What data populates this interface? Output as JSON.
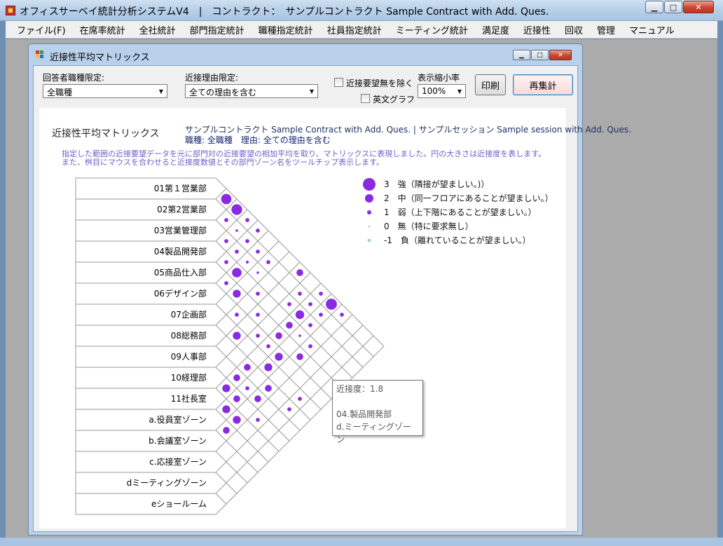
{
  "window": {
    "title": "オフィスサーベイ統計分析システムV4　|　コントラクト：　サンプルコントラクト Sample Contract with Add. Ques.",
    "minimize_glyph": "▁",
    "maximize_glyph": "□",
    "close_glyph": "✕"
  },
  "menu": [
    {
      "label": "ファイル(F)"
    },
    {
      "label": "在席率統計"
    },
    {
      "label": "全社統計"
    },
    {
      "label": "部門指定統計"
    },
    {
      "label": "職種指定統計"
    },
    {
      "label": "社員指定統計"
    },
    {
      "label": "ミーティング統計"
    },
    {
      "label": "満足度"
    },
    {
      "label": "近接性"
    },
    {
      "label": "回収"
    },
    {
      "label": "管理"
    },
    {
      "label": "マニュアル"
    }
  ],
  "dialog": {
    "title": "近接性平均マトリックス",
    "occupation_label": "回答者職種限定:",
    "occupation_value": "全職種",
    "reason_label": "近接理由限定:",
    "reason_value": "全ての理由を含む",
    "exclude_label": "近接要望無を除く",
    "english_label": "英文グラフ",
    "zoom_label": "表示縮小率",
    "zoom_value": "100%",
    "print_button": "印刷",
    "recalc_button": "再集計"
  },
  "panel": {
    "title": "近接性平均マトリックス",
    "info_line1": "サンプルコントラクト Sample Contract with Add. Ques. | サンプルセッション Sample session with Add. Ques.",
    "info_line2_prefix": "職種: ",
    "info_line2_value": "全職種",
    "info_line2_mid": "　理由: ",
    "info_line2_reason": "全ての理由を含む",
    "desc1": "指定した範囲の近接要望データを元に部門対の近接要望の相加平均を取り、マトリックスに表現しました。円の大きさは近接度を表します。",
    "desc2": "また、桝目にマウスを合わせると近接度数値とその部門ゾーン名をツールチップ表示します。"
  },
  "departments": [
    "01第１営業部",
    "02第2営業部",
    "03営業管理部",
    "04製品開発部",
    "05商品仕入部",
    "06デザイン部",
    "07企画部",
    "08総務部",
    "09人事部",
    "10経理部",
    "11社長室",
    "a.役員室ゾーン",
    "b.会議室ゾーン",
    "c.応接室ゾーン",
    "dミーティングゾーン",
    "eショールーム"
  ],
  "legend": [
    {
      "value": 3,
      "text": "3　強（隣接が望ましい。)）",
      "color": "#8a2be2"
    },
    {
      "value": 2,
      "text": "2　中（同一フロアにあることが望ましい。）",
      "color": "#8a2be2"
    },
    {
      "value": 1,
      "text": "1　弱（上下階にあることが望ましい。）",
      "color": "#8a2be2"
    },
    {
      "value": 0,
      "text": "0　無（特に要求無し）",
      "color": "#8a2be2"
    },
    {
      "value": -1,
      "text": "-1　負（離れていることが望ましい。）",
      "color": "#9fd3da"
    }
  ],
  "matrix_cells": [
    {
      "i": 0,
      "j": 1,
      "v": 2.2
    },
    {
      "i": 0,
      "j": 2,
      "v": 2.3
    },
    {
      "i": 1,
      "j": 2,
      "v": 0.6
    },
    {
      "i": 2,
      "j": 3,
      "v": 0.6
    },
    {
      "i": 1,
      "j": 4,
      "v": 0.6
    },
    {
      "i": 2,
      "j": 4,
      "v": 0.6
    },
    {
      "i": 3,
      "j": 4,
      "v": 0.6
    },
    {
      "i": 0,
      "j": 3,
      "v": 0.6
    },
    {
      "i": 0,
      "j": 4,
      "v": 0.6
    },
    {
      "i": 1,
      "j": 3,
      "v": 0.2
    },
    {
      "i": 1,
      "j": 5,
      "v": 0.6
    },
    {
      "i": 2,
      "j": 5,
      "v": 0.3
    },
    {
      "i": 1,
      "j": 6,
      "v": 0.6
    },
    {
      "i": 3,
      "j": 5,
      "v": 2.0
    },
    {
      "i": 4,
      "j": 5,
      "v": 0.6
    },
    {
      "i": 2,
      "j": 6,
      "v": 0.2
    },
    {
      "i": 4,
      "j": 6,
      "v": 1.6
    },
    {
      "i": 3,
      "j": 7,
      "v": 0.6
    },
    {
      "i": 5,
      "j": 7,
      "v": 0.6
    },
    {
      "i": 4,
      "j": 8,
      "v": 0.6
    },
    {
      "i": 6,
      "j": 8,
      "v": 1.6
    },
    {
      "i": 4,
      "j": 10,
      "v": 1.3
    },
    {
      "i": 3,
      "j": 11,
      "v": 0.2
    },
    {
      "i": 0,
      "j": 8,
      "v": 1.3
    },
    {
      "i": 1,
      "j": 9,
      "v": 0.6
    },
    {
      "i": 1,
      "j": 10,
      "v": 0.6
    },
    {
      "i": 2,
      "j": 9,
      "v": 0.6
    },
    {
      "i": 2,
      "j": 10,
      "v": 1.8
    },
    {
      "i": 2,
      "j": 11,
      "v": 0.6
    },
    {
      "i": 1,
      "j": 11,
      "v": 0.6
    },
    {
      "i": 0,
      "j": 10,
      "v": 0.6
    },
    {
      "i": 0,
      "j": 11,
      "v": 2.4
    },
    {
      "i": 0,
      "j": 12,
      "v": 0.6
    },
    {
      "i": 3,
      "j": 10,
      "v": 1.3
    },
    {
      "i": 3,
      "j": 12,
      "v": 0.6
    },
    {
      "i": 4,
      "j": 12,
      "v": 1.3
    },
    {
      "i": 5,
      "j": 11,
      "v": 1.6
    },
    {
      "i": 6,
      "j": 11,
      "v": 1.6
    },
    {
      "i": 7,
      "j": 10,
      "v": 1.3
    },
    {
      "i": 8,
      "j": 10,
      "v": 1.3
    },
    {
      "i": 8,
      "j": 11,
      "v": 0.6
    },
    {
      "i": 7,
      "j": 12,
      "v": 1.3
    },
    {
      "i": 8,
      "j": 12,
      "v": 1.3
    },
    {
      "i": 9,
      "j": 10,
      "v": 1.6
    },
    {
      "i": 9,
      "j": 11,
      "v": 1.3
    },
    {
      "i": 10,
      "j": 11,
      "v": 1.6
    },
    {
      "i": 10,
      "j": 12,
      "v": 1.6
    },
    {
      "i": 11,
      "j": 12,
      "v": 1.3
    },
    {
      "i": 9,
      "j": 13,
      "v": 0.6
    },
    {
      "i": 6,
      "j": 14,
      "v": 0.6
    },
    {
      "i": 7,
      "j": 14,
      "v": 0.6
    },
    {
      "i": 5,
      "j": 9,
      "v": 0.6
    },
    {
      "i": 5,
      "j": 10,
      "v": 0.6
    }
  ],
  "tooltip": {
    "line1": "近接度：1.8",
    "line2": "04.製品開発部",
    "line3": "d.ミーティングゾーン"
  }
}
